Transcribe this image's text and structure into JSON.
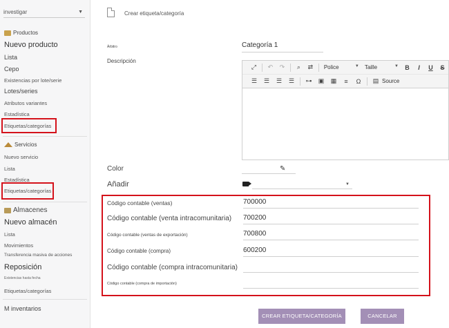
{
  "sidebar": {
    "search_select": "investigar",
    "productos": {
      "header": "Productos",
      "new": "Nuevo producto",
      "items": [
        "Lista",
        "Cepo",
        "Existencias por lote/serie",
        "Lotes/series",
        "Atributos variantes",
        "Estadística",
        "Etiquetas/categorías"
      ]
    },
    "servicios": {
      "header": "Servicios",
      "items": [
        "Nuevo servicio",
        "Lista",
        "Estadística",
        "Etiquetas/categorías"
      ]
    },
    "almacenes": {
      "header": "Almacenes",
      "new": "Nuevo almacén",
      "items": [
        "Lista",
        "Movimientos",
        "Transferencia masiva de acciones"
      ]
    },
    "reposicion": {
      "header": "Reposición",
      "items": [
        "Existencias hasta fecha",
        "Etiquetas/categorías"
      ]
    },
    "inventarios": "M inventarios"
  },
  "main": {
    "title": "Crear etiqueta/categoría",
    "arbitro_label": "Árbitro",
    "arbitro_value": "Categoría 1",
    "descripcion_label": "Descripción",
    "toolbar": {
      "font_label": "Police",
      "size_label": "Taille",
      "bold": "B",
      "italic": "I",
      "underline": "U",
      "strike": "S",
      "omega": "Ω",
      "source": "Source"
    },
    "color_label": "Color",
    "anadir_label": "Añadir",
    "accounts": [
      {
        "label": "Código contable (ventas)",
        "value": "700000"
      },
      {
        "label": "Código contable (venta intracomunitaria)",
        "value": "700200"
      },
      {
        "label": "Código contable (ventas de exportación)",
        "value": "700800"
      },
      {
        "label": "Código contable (compra)",
        "value": "600200"
      },
      {
        "label": "Código contable (compra intracomunitaria)",
        "value": ""
      },
      {
        "label": "Código contable (compra de importación)",
        "value": ""
      }
    ],
    "create_button": "CREAR ETIQUETA/CATEGORÍA",
    "cancel_button": "CANCELAR"
  },
  "colors": {
    "highlight": "#d4111a",
    "button": "#a38fb6"
  }
}
